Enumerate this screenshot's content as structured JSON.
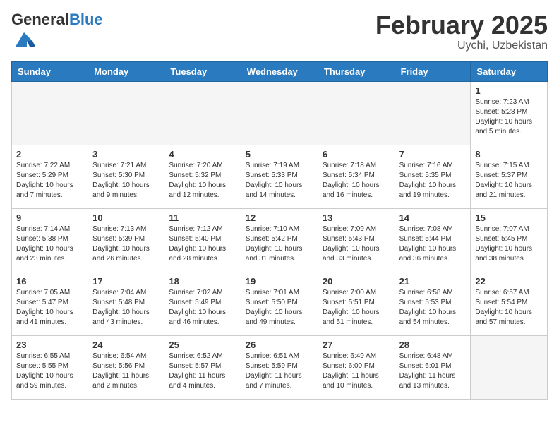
{
  "header": {
    "logo_general": "General",
    "logo_blue": "Blue",
    "month_year": "February 2025",
    "location": "Uychi, Uzbekistan"
  },
  "weekdays": [
    "Sunday",
    "Monday",
    "Tuesday",
    "Wednesday",
    "Thursday",
    "Friday",
    "Saturday"
  ],
  "weeks": [
    [
      {
        "day": "",
        "info": ""
      },
      {
        "day": "",
        "info": ""
      },
      {
        "day": "",
        "info": ""
      },
      {
        "day": "",
        "info": ""
      },
      {
        "day": "",
        "info": ""
      },
      {
        "day": "",
        "info": ""
      },
      {
        "day": "1",
        "info": "Sunrise: 7:23 AM\nSunset: 5:28 PM\nDaylight: 10 hours\nand 5 minutes."
      }
    ],
    [
      {
        "day": "2",
        "info": "Sunrise: 7:22 AM\nSunset: 5:29 PM\nDaylight: 10 hours\nand 7 minutes."
      },
      {
        "day": "3",
        "info": "Sunrise: 7:21 AM\nSunset: 5:30 PM\nDaylight: 10 hours\nand 9 minutes."
      },
      {
        "day": "4",
        "info": "Sunrise: 7:20 AM\nSunset: 5:32 PM\nDaylight: 10 hours\nand 12 minutes."
      },
      {
        "day": "5",
        "info": "Sunrise: 7:19 AM\nSunset: 5:33 PM\nDaylight: 10 hours\nand 14 minutes."
      },
      {
        "day": "6",
        "info": "Sunrise: 7:18 AM\nSunset: 5:34 PM\nDaylight: 10 hours\nand 16 minutes."
      },
      {
        "day": "7",
        "info": "Sunrise: 7:16 AM\nSunset: 5:35 PM\nDaylight: 10 hours\nand 19 minutes."
      },
      {
        "day": "8",
        "info": "Sunrise: 7:15 AM\nSunset: 5:37 PM\nDaylight: 10 hours\nand 21 minutes."
      }
    ],
    [
      {
        "day": "9",
        "info": "Sunrise: 7:14 AM\nSunset: 5:38 PM\nDaylight: 10 hours\nand 23 minutes."
      },
      {
        "day": "10",
        "info": "Sunrise: 7:13 AM\nSunset: 5:39 PM\nDaylight: 10 hours\nand 26 minutes."
      },
      {
        "day": "11",
        "info": "Sunrise: 7:12 AM\nSunset: 5:40 PM\nDaylight: 10 hours\nand 28 minutes."
      },
      {
        "day": "12",
        "info": "Sunrise: 7:10 AM\nSunset: 5:42 PM\nDaylight: 10 hours\nand 31 minutes."
      },
      {
        "day": "13",
        "info": "Sunrise: 7:09 AM\nSunset: 5:43 PM\nDaylight: 10 hours\nand 33 minutes."
      },
      {
        "day": "14",
        "info": "Sunrise: 7:08 AM\nSunset: 5:44 PM\nDaylight: 10 hours\nand 36 minutes."
      },
      {
        "day": "15",
        "info": "Sunrise: 7:07 AM\nSunset: 5:45 PM\nDaylight: 10 hours\nand 38 minutes."
      }
    ],
    [
      {
        "day": "16",
        "info": "Sunrise: 7:05 AM\nSunset: 5:47 PM\nDaylight: 10 hours\nand 41 minutes."
      },
      {
        "day": "17",
        "info": "Sunrise: 7:04 AM\nSunset: 5:48 PM\nDaylight: 10 hours\nand 43 minutes."
      },
      {
        "day": "18",
        "info": "Sunrise: 7:02 AM\nSunset: 5:49 PM\nDaylight: 10 hours\nand 46 minutes."
      },
      {
        "day": "19",
        "info": "Sunrise: 7:01 AM\nSunset: 5:50 PM\nDaylight: 10 hours\nand 49 minutes."
      },
      {
        "day": "20",
        "info": "Sunrise: 7:00 AM\nSunset: 5:51 PM\nDaylight: 10 hours\nand 51 minutes."
      },
      {
        "day": "21",
        "info": "Sunrise: 6:58 AM\nSunset: 5:53 PM\nDaylight: 10 hours\nand 54 minutes."
      },
      {
        "day": "22",
        "info": "Sunrise: 6:57 AM\nSunset: 5:54 PM\nDaylight: 10 hours\nand 57 minutes."
      }
    ],
    [
      {
        "day": "23",
        "info": "Sunrise: 6:55 AM\nSunset: 5:55 PM\nDaylight: 10 hours\nand 59 minutes."
      },
      {
        "day": "24",
        "info": "Sunrise: 6:54 AM\nSunset: 5:56 PM\nDaylight: 11 hours\nand 2 minutes."
      },
      {
        "day": "25",
        "info": "Sunrise: 6:52 AM\nSunset: 5:57 PM\nDaylight: 11 hours\nand 4 minutes."
      },
      {
        "day": "26",
        "info": "Sunrise: 6:51 AM\nSunset: 5:59 PM\nDaylight: 11 hours\nand 7 minutes."
      },
      {
        "day": "27",
        "info": "Sunrise: 6:49 AM\nSunset: 6:00 PM\nDaylight: 11 hours\nand 10 minutes."
      },
      {
        "day": "28",
        "info": "Sunrise: 6:48 AM\nSunset: 6:01 PM\nDaylight: 11 hours\nand 13 minutes."
      },
      {
        "day": "",
        "info": ""
      }
    ]
  ]
}
